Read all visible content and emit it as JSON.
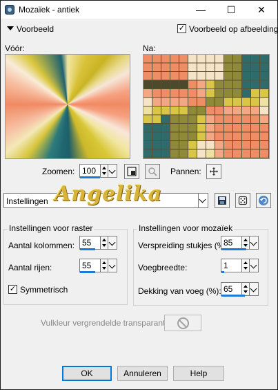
{
  "window": {
    "title": "Mozaïek - antiek",
    "minimize_glyph": "—",
    "maximize_glyph": "☐",
    "close_glyph": "✕"
  },
  "preview": {
    "toggle_label": "Voorbeeld",
    "checkbox_label": "Voorbeeld op afbeelding",
    "checkbox_checked": true,
    "before_label": "Vóór:",
    "after_label": "Na:"
  },
  "zoom": {
    "label": "Zoomen:",
    "value": "100",
    "pan_label": "Pannen:"
  },
  "settings": {
    "label": "Instellingen",
    "watermark": "Angelika"
  },
  "grid_group": {
    "title": "Instellingen voor raster",
    "columns_label": "Aantal kolommen:",
    "columns_value": "55",
    "rows_label": "Aantal rijen:",
    "rows_value": "55",
    "symmetric_label": "Symmetrisch",
    "symmetric_checked": true
  },
  "mosaic_group": {
    "title": "Instellingen voor mozaïek",
    "spread_label": "Verspreiding stukjes (%):",
    "spread_value": "85",
    "joint_width_label": "Voegbreedte:",
    "joint_width_value": "1",
    "joint_coverage_label": "Dekking van voeg (%):",
    "joint_coverage_value": "65"
  },
  "fill": {
    "label": "Vulkleur vergrendelde transparantie:"
  },
  "buttons": {
    "ok": "OK",
    "cancel": "Annuleren",
    "help": "Help"
  },
  "colors": {
    "accent": "#1e7ad8",
    "default_button_border": "#0078d7"
  }
}
